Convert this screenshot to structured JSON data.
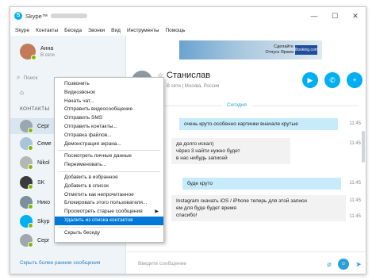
{
  "window": {
    "app_title": "Skype™",
    "controls": [
      "—",
      "☐",
      "✕"
    ]
  },
  "menubar": [
    "Skype",
    "Контакты",
    "Беседа",
    "Звонки",
    "Вид",
    "Инструменты",
    "Помощь"
  ],
  "profile": {
    "name": "Анна",
    "status": "В сети"
  },
  "search": {
    "placeholder": "Поиск"
  },
  "contacts_header": "КОНТАКТЫ",
  "contacts": [
    {
      "name": "Серг",
      "avatar_color": "#9aa7b0",
      "status_color": "#7fba00"
    },
    {
      "name": "Семе",
      "avatar_color": "#a7c4d8",
      "status_color": "#7fba00"
    },
    {
      "name": "Nikol",
      "avatar_color": "#b6b6b6",
      "status_color": "#7fba00"
    },
    {
      "name": "SK",
      "avatar_color": "#3b3b3b",
      "status_color": "#7fba00"
    },
    {
      "name": "Нико",
      "avatar_color": "#7d8f9b",
      "status_color": "#7fba00"
    },
    {
      "name": "Skyp",
      "avatar_color": "#00aff0",
      "status_color": "#7fba00"
    },
    {
      "name": "Серг",
      "avatar_color": "#a0a8ad",
      "status_color": "#7fba00"
    }
  ],
  "sidebar_footer": "Скрыть более ранние сообщения",
  "ad": {
    "text_line1": "Сделайте",
    "text_line2": "Отпуск Ярким",
    "logo": "Booking.com"
  },
  "chat": {
    "contact_name": "Станислав",
    "contact_status": "В сети | Москва, Россия",
    "date_label": "Сегодня",
    "messages": [
      {
        "text": "очень круто.особенно картинки вначале крутые",
        "time": "11:45",
        "dir": "out"
      },
      {
        "text": "да долго искал)",
        "time": "11:45",
        "dir": "in"
      },
      {
        "text": "чёрез 3 найти нужно будет",
        "time": "",
        "dir": "in"
      },
      {
        "text": "в нас нибудь записей",
        "time": "",
        "dir": "in"
      },
      {
        "text": "буде круто",
        "time": "11:45",
        "dir": "out"
      },
      {
        "text": "Instagram скачать iOS / iPhone  теперь для этой записи",
        "time": "11:45",
        "dir": "in"
      },
      {
        "text": "ем для буде будет время",
        "time": "",
        "dir": "in"
      },
      {
        "text": "спасибо!",
        "time": "11:45",
        "dir": "in"
      }
    ],
    "compose_placeholder": "Введите сообщение"
  },
  "context_menu": {
    "items": [
      {
        "label": "Позвонить",
        "sep_before": false,
        "submenu": false,
        "highlight": false
      },
      {
        "label": "Видеозвонок",
        "sep_before": false,
        "submenu": false,
        "highlight": false
      },
      {
        "label": "Начать чат...",
        "sep_before": false,
        "submenu": false,
        "highlight": false
      },
      {
        "label": "Отправить видеосообщение",
        "sep_before": false,
        "submenu": false,
        "highlight": false
      },
      {
        "label": "Отправить SMS",
        "sep_before": false,
        "submenu": false,
        "highlight": false
      },
      {
        "label": "Отправить контакты...",
        "sep_before": false,
        "submenu": false,
        "highlight": false
      },
      {
        "label": "Отправка файлов...",
        "sep_before": false,
        "submenu": false,
        "highlight": false
      },
      {
        "label": "Демонстрация экрана...",
        "sep_before": false,
        "submenu": false,
        "highlight": false
      },
      {
        "label": "Посмотреть личные данные",
        "sep_before": true,
        "submenu": false,
        "highlight": false
      },
      {
        "label": "Переименовать...",
        "sep_before": false,
        "submenu": false,
        "highlight": false
      },
      {
        "label": "Добавить в избранное",
        "sep_before": true,
        "submenu": false,
        "highlight": false
      },
      {
        "label": "Добавить в список",
        "sep_before": false,
        "submenu": false,
        "highlight": false
      },
      {
        "label": "Отметить как непрочитанное",
        "sep_before": false,
        "submenu": false,
        "highlight": false
      },
      {
        "label": "Блокировать этого пользователя...",
        "sep_before": false,
        "submenu": false,
        "highlight": false
      },
      {
        "label": "Просмотреть старые сообщения",
        "sep_before": false,
        "submenu": true,
        "highlight": false
      },
      {
        "label": "Удалить из списка контактов",
        "sep_before": false,
        "submenu": false,
        "highlight": true
      },
      {
        "label": "Скрыть беседу",
        "sep_before": true,
        "submenu": false,
        "highlight": false
      }
    ]
  },
  "colors": {
    "accent": "#00aff0",
    "selection": "#0078d7",
    "online": "#7fba00"
  }
}
